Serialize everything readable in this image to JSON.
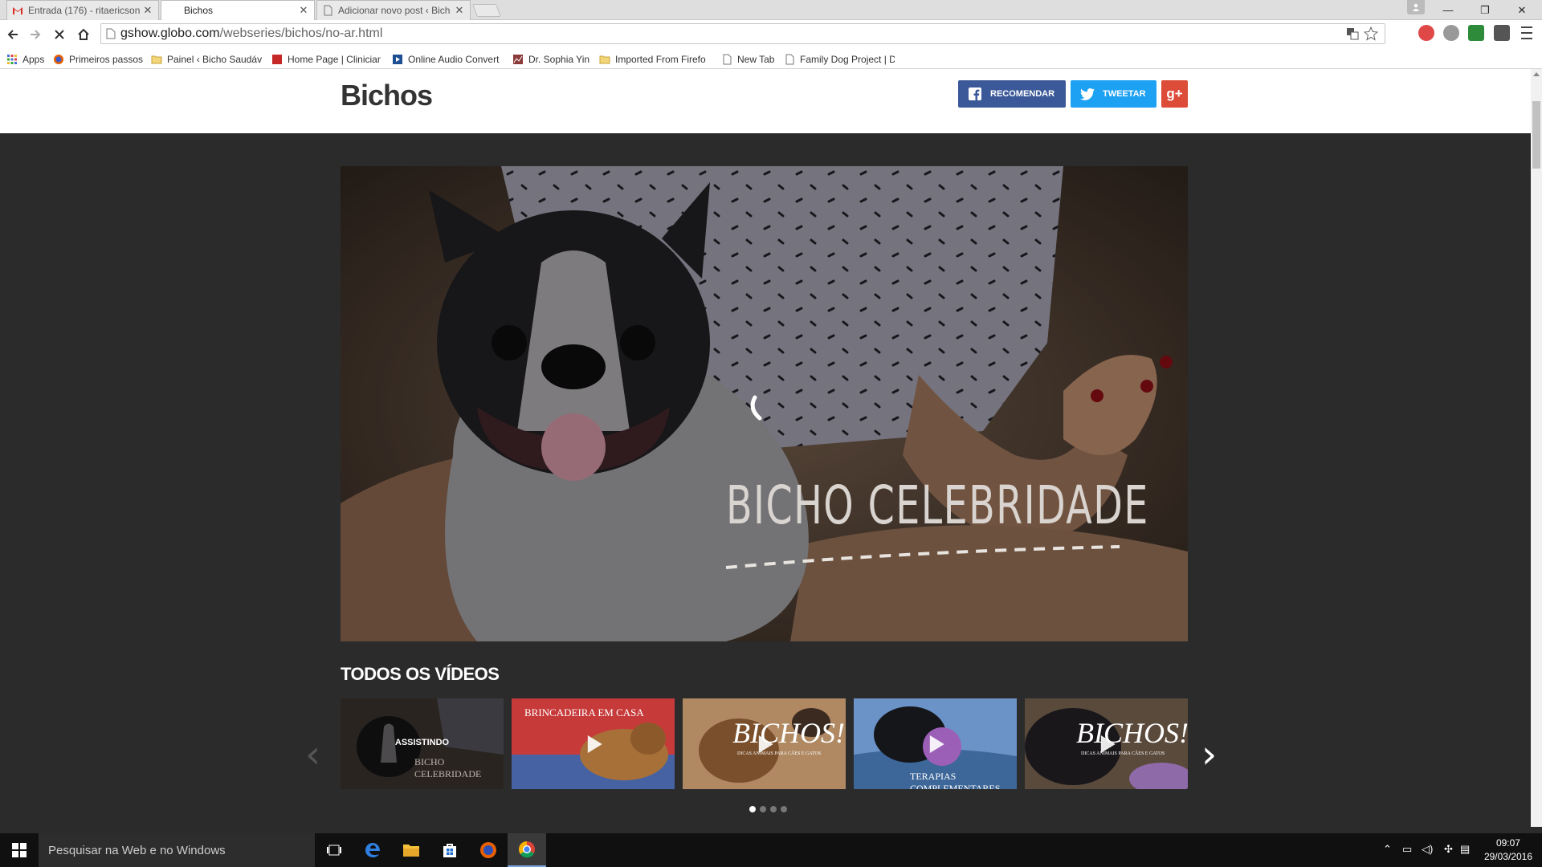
{
  "browser": {
    "tabs": [
      {
        "label": "Entrada (176) - ritaericson",
        "active": false,
        "icon": "gmail-icon"
      },
      {
        "label": "Bichos",
        "active": true,
        "icon": "none"
      },
      {
        "label": "Adicionar novo post ‹ Bich",
        "active": false,
        "icon": "page-icon"
      }
    ],
    "close_glyph": "✕",
    "window_controls": {
      "minimize": "—",
      "restore": "❐",
      "close": "✕"
    },
    "url_domain": "gshow.globo.com",
    "url_path": "/webseries/bichos/no-ar.html",
    "bookmarks": [
      {
        "label": "Apps",
        "icon": "apps-icon"
      },
      {
        "label": "Primeiros passos",
        "icon": "firefox-icon"
      },
      {
        "label": "Painel ‹ Bicho Saudáv",
        "icon": "folder-icon"
      },
      {
        "label": "Home Page | Clinician",
        "icon": "red-square-icon"
      },
      {
        "label": "Online Audio Convert",
        "icon": "play-icon"
      },
      {
        "label": "Dr. Sophia Yin",
        "icon": "chart-icon"
      },
      {
        "label": "Imported From Firefo",
        "icon": "folder-icon"
      },
      {
        "label": "New Tab",
        "icon": "page-icon"
      },
      {
        "label": "Family Dog Project | D",
        "icon": "page-icon"
      }
    ]
  },
  "page": {
    "brand": "Bichos",
    "social": {
      "recommend": "RECOMENDAR",
      "tweet": "TWEETAR",
      "gplus": "g+"
    },
    "hero_title": "BICHO CELEBRIDADE",
    "section_title": "TODOS OS VÍDEOS",
    "thumbnails": [
      {
        "overlay": "ASSISTINDO",
        "caption": "BICHO CELEBRIDADE"
      },
      {
        "overlay": "",
        "caption": "BRINCADEIRA EM CASA"
      },
      {
        "overlay": "BICHOS!",
        "caption": "DICAS ANIMAIS PARA CÃES E GATOS"
      },
      {
        "overlay": "",
        "caption": "TERAPIAS COMPLEMENTARES"
      },
      {
        "overlay": "BICHOS!",
        "caption": "DICAS ANIMAIS PARA CÃES E GATOS"
      }
    ],
    "carousel_dots": 4,
    "carousel_active_dot": 0,
    "next_arrow": "›",
    "prev_arrow": "‹"
  },
  "taskbar": {
    "search_placeholder": "Pesquisar na Web e no Windows",
    "time": "09:07",
    "date": "29/03/2016"
  },
  "colors": {
    "facebook": "#3b5998",
    "twitter": "#1da1f2",
    "gplus": "#dd4b39",
    "page_bg": "#2b2b2b"
  }
}
